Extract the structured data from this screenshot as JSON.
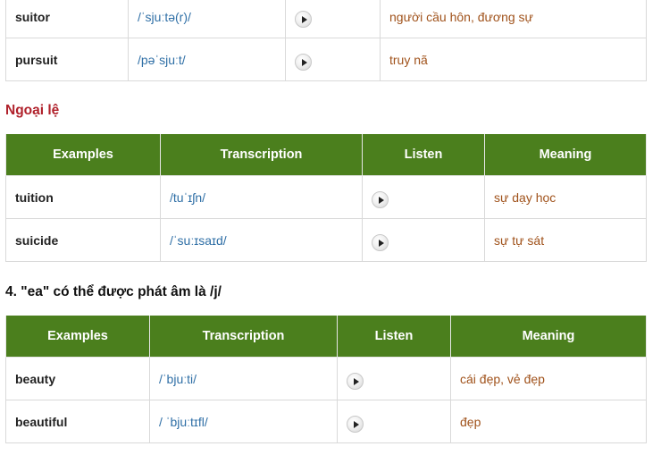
{
  "top_rows": [
    {
      "word": "suitor",
      "ipa": "/ˈsjuːtə(r)/",
      "meaning": "người cầu hôn, đương sự"
    },
    {
      "word": "pursuit",
      "ipa": "/pəˈsjuːt/",
      "meaning": "truy nã"
    }
  ],
  "exceptions": {
    "heading": "Ngoại lệ",
    "headers": {
      "examples": "Examples",
      "transcription": "Transcription",
      "listen": "Listen",
      "meaning": "Meaning"
    },
    "rows": [
      {
        "word": "tuition",
        "ipa": "/tuˈɪʃn/",
        "meaning": "sự dạy học"
      },
      {
        "word": "suicide",
        "ipa": "/ˈsuːɪsaɪd/",
        "meaning": "sự tự sát"
      }
    ]
  },
  "section4": {
    "heading": "4. \"ea\" có thể được phát âm là /j/",
    "headers": {
      "examples": "Examples",
      "transcription": "Transcription",
      "listen": "Listen",
      "meaning": "Meaning"
    },
    "rows": [
      {
        "word": "beauty",
        "ipa": "/ˈbjuːti/",
        "meaning": "cái đẹp, vẻ đẹp"
      },
      {
        "word": "beautiful",
        "ipa": "/ ˈbjuːtɪfl/",
        "meaning": "đẹp"
      }
    ]
  },
  "colors": {
    "header_bg": "#4b7f1d",
    "ipa_text": "#2f6fa6",
    "meaning_text": "#a0521b",
    "exception_heading": "#b0212b"
  },
  "icons": {
    "listen": "play-icon"
  }
}
